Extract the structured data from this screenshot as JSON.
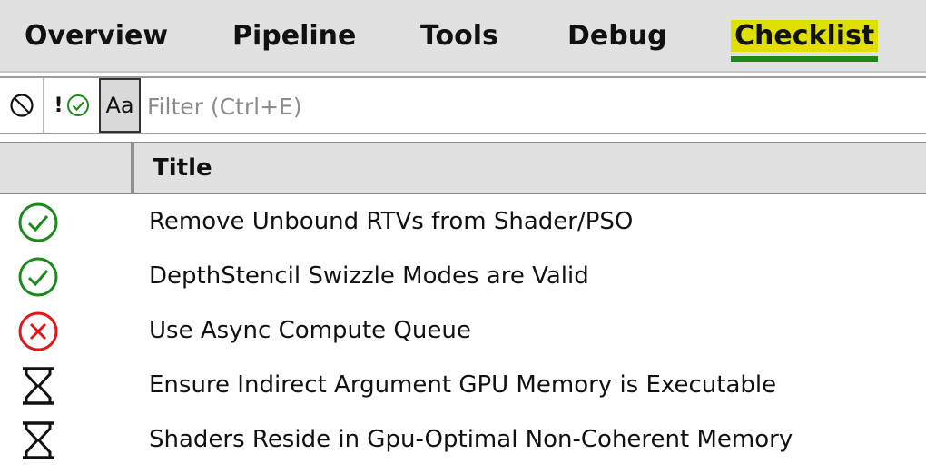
{
  "tabs": [
    {
      "label": "Overview",
      "active": false
    },
    {
      "label": "Pipeline",
      "active": false
    },
    {
      "label": "Tools",
      "active": false
    },
    {
      "label": "Debug",
      "active": false
    },
    {
      "label": "Checklist",
      "active": true
    }
  ],
  "toolbar": {
    "clear_icon": "prohibited-icon",
    "bang_label": "!",
    "status_filter_icon": "check-circle-icon",
    "case_toggle_label": "Aa",
    "filter_placeholder": "Filter (Ctrl+E)",
    "filter_value": ""
  },
  "table": {
    "column_title": "Title",
    "rows": [
      {
        "status": "pass",
        "icon": "check-circle-icon",
        "title": "Remove Unbound RTVs from Shader/PSO"
      },
      {
        "status": "pass",
        "icon": "check-circle-icon",
        "title": "DepthStencil Swizzle Modes are Valid"
      },
      {
        "status": "fail",
        "icon": "x-circle-icon",
        "title": "Use Async Compute Queue"
      },
      {
        "status": "pending",
        "icon": "hourglass-icon",
        "title": "Ensure Indirect Argument GPU Memory is Executable"
      },
      {
        "status": "pending",
        "icon": "hourglass-icon",
        "title": "Shaders Reside in Gpu-Optimal Non-Coherent Memory"
      }
    ]
  },
  "colors": {
    "pass": "#1a8a1a",
    "fail": "#e0161b",
    "pending": "#111111",
    "active_tab_highlight": "#dfe000",
    "active_tab_underline": "#1a8a1a"
  }
}
